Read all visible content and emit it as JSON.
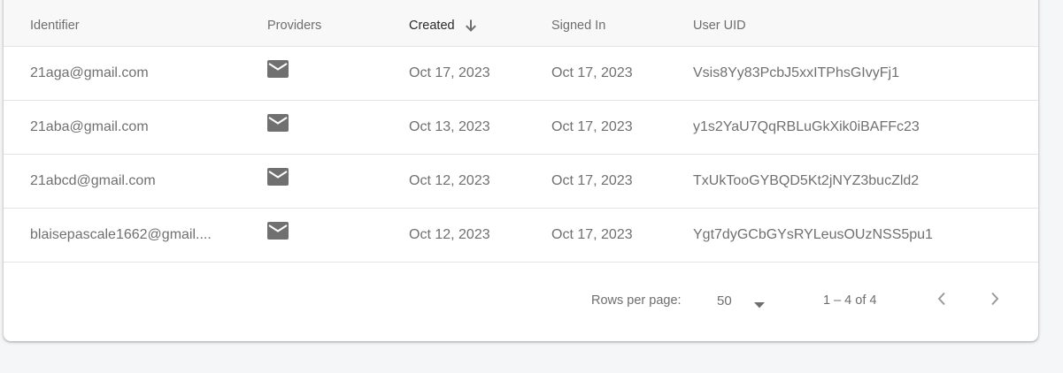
{
  "table": {
    "columns": {
      "identifier": "Identifier",
      "providers": "Providers",
      "created": "Created",
      "signed_in": "Signed In",
      "user_uid": "User UID"
    },
    "sort": {
      "column": "created",
      "direction": "descending",
      "icon": "arrow-down-icon"
    },
    "rows": [
      {
        "identifier": "21aga@gmail.com",
        "provider_icon": "email-icon",
        "created": "Oct 17, 2023",
        "signed_in": "Oct 17, 2023",
        "user_uid": "Vsis8Yy83PcbJ5xxITPhsGIvyFj1"
      },
      {
        "identifier": "21aba@gmail.com",
        "provider_icon": "email-icon",
        "created": "Oct 13, 2023",
        "signed_in": "Oct 17, 2023",
        "user_uid": "y1s2YaU7QqRBLuGkXik0iBAFFc23"
      },
      {
        "identifier": "21abcd@gmail.com",
        "provider_icon": "email-icon",
        "created": "Oct 12, 2023",
        "signed_in": "Oct 17, 2023",
        "user_uid": "TxUkTooGYBQD5Kt2jNYZ3bucZld2"
      },
      {
        "identifier": "blaisepascale1662@gmail....",
        "provider_icon": "email-icon",
        "created": "Oct 12, 2023",
        "signed_in": "Oct 17, 2023",
        "user_uid": "Ygt7dyGCbGYsRYLeusOUzNSS5pu1"
      }
    ]
  },
  "pagination": {
    "rows_per_page_label": "Rows per page:",
    "rows_per_page_value": "50",
    "range_label": "1 – 4 of 4",
    "prev_icon": "chevron-left-icon",
    "next_icon": "chevron-right-icon"
  },
  "colors": {
    "page_background": "#f5f6f8",
    "card_background": "#ffffff",
    "header_background": "#f8f8f8",
    "divider": "#e4e4e4",
    "text": "#707070",
    "icon": "#707070"
  }
}
